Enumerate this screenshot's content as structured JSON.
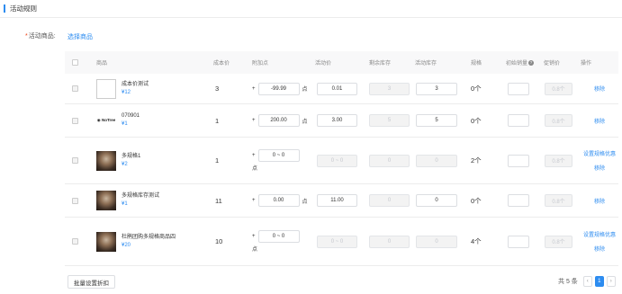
{
  "section": {
    "title": "活动规则"
  },
  "form": {
    "required_mark": "*",
    "label": "活动商品:",
    "select_link": "选择商品"
  },
  "columns": [
    "商品",
    "成本价",
    "附加点",
    "活动价",
    "剩余库存",
    "活动库存",
    "规格",
    "初始销量",
    "促销价",
    "操作"
  ],
  "col_extra_icon": "question-icon",
  "rows": [
    {
      "name": "成本价测试",
      "price": "¥12",
      "cost": "3",
      "plus": "+",
      "points": "-99.99",
      "unit": "点",
      "act_price": "0.01",
      "remain": "3",
      "stock": "3",
      "spec": "0个",
      "init_sales": "",
      "promo": "0.8个",
      "ops": [
        "移除"
      ],
      "thumb": "blank"
    },
    {
      "name": "070901",
      "price": "¥1",
      "cost": "1",
      "plus": "+",
      "points": "200.00",
      "unit": "点",
      "act_price": "3.00",
      "remain": "5",
      "stock": "5",
      "spec": "0个",
      "init_sales": "",
      "promo": "0.8个",
      "ops": [
        "移除"
      ],
      "thumb": "logo",
      "logo_text": "◉ NoTree"
    },
    {
      "name": "多规格1",
      "price": "¥2",
      "cost": "1",
      "plus": "+",
      "points": "0 ~ 0",
      "unit": "点",
      "act_price": "0 ~ 0",
      "remain": "0",
      "stock": "0",
      "spec": "2个",
      "init_sales": "",
      "promo": "0.8个",
      "ops": [
        "设置规格优惠",
        "移除"
      ],
      "thumb": "photo"
    },
    {
      "name": "多规格库存测试",
      "price": "¥1",
      "cost": "11",
      "plus": "+",
      "points": "0.00",
      "unit": "点",
      "act_price": "11.00",
      "remain": "0",
      "stock": "0",
      "spec": "0个",
      "init_sales": "",
      "promo": "0.8个",
      "ops": [
        "移除"
      ],
      "thumb": "photo"
    },
    {
      "name": "杜鹃团购多规格商品四",
      "price": "¥20",
      "cost": "10",
      "plus": "+",
      "points": "0 ~ 0",
      "unit": "点",
      "act_price": "0 ~ 0",
      "remain": "0",
      "stock": "0",
      "spec": "4个",
      "init_sales": "",
      "promo": "0.8个",
      "ops": [
        "设置规格优惠",
        "移除"
      ],
      "thumb": "photo"
    }
  ],
  "footer": {
    "batch_button": "批量设置折扣",
    "total": "共 5 条",
    "current_page": "1",
    "prev": "‹",
    "next": "›"
  }
}
